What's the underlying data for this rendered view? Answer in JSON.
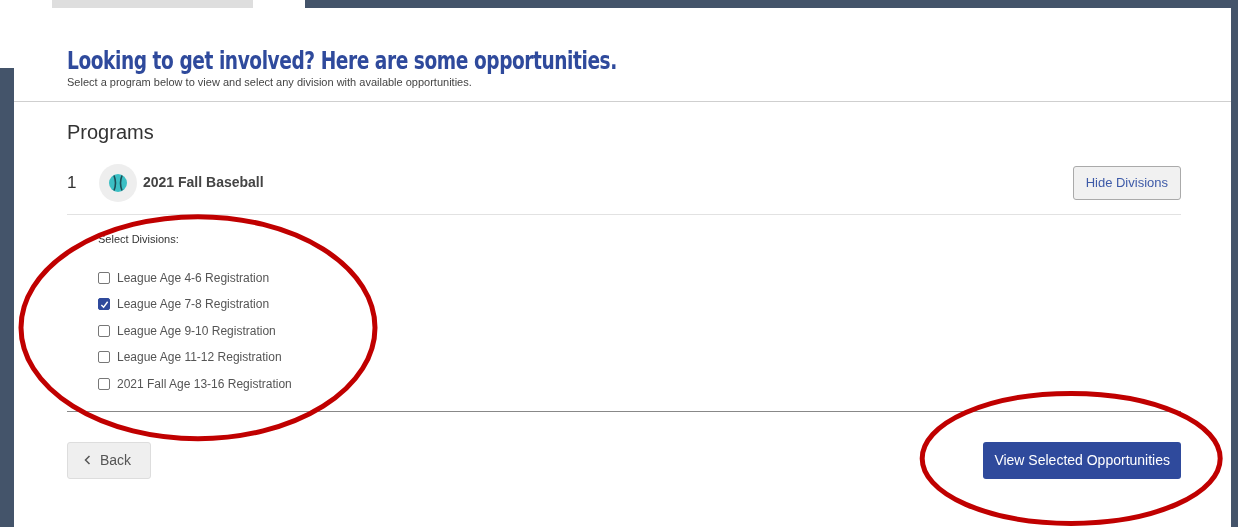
{
  "header": {
    "title": "Looking to get involved? Here are some opportunities.",
    "subtitle": "Select a program below to view and select any division with available opportunities."
  },
  "programs_heading": "Programs",
  "programs": [
    {
      "number": "1",
      "name": "2021 Fall Baseball",
      "toggle_button": "Hide Divisions",
      "expanded": true,
      "divisions_label": "Select Divisions:",
      "divisions": [
        {
          "label": "League Age 4-6 Registration",
          "checked": false
        },
        {
          "label": "League Age 7-8 Registration",
          "checked": true
        },
        {
          "label": "League Age 9-10 Registration",
          "checked": false
        },
        {
          "label": "League Age 11-12 Registration",
          "checked": false
        },
        {
          "label": "2021 Fall Age 13-16 Registration",
          "checked": false
        }
      ]
    }
  ],
  "back_button": "Back",
  "submit_button": "View Selected Opportunities",
  "annotations": [
    {
      "kind": "ellipse",
      "color": "#c00000"
    },
    {
      "kind": "ellipse",
      "color": "#c00000"
    }
  ]
}
